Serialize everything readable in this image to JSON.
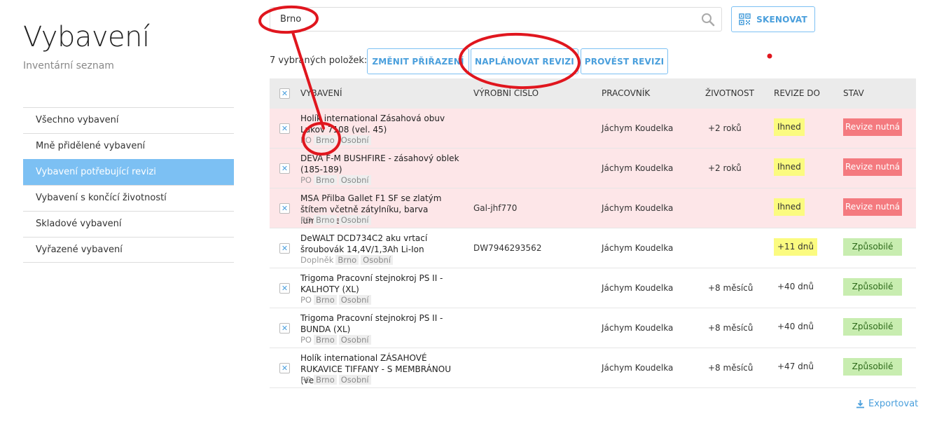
{
  "page": {
    "title": "Vybavení",
    "subtitle": "Inventární seznam"
  },
  "sidebar": {
    "items": [
      {
        "label": "Všechno vybavení",
        "active": false
      },
      {
        "label": "Mně přidělené vybavení",
        "active": false
      },
      {
        "label": "Vybavení potřebující revizi",
        "active": true
      },
      {
        "label": "Vybavení s končící životností",
        "active": false
      },
      {
        "label": "Skladové vybavení",
        "active": false
      },
      {
        "label": "Vyřazené vybavení",
        "active": false
      }
    ]
  },
  "search": {
    "value": "Brno",
    "icon": "search-icon"
  },
  "scan_button": {
    "label": "SKENOVAT",
    "icon": "qr-code-icon"
  },
  "actions": {
    "selected_count": "7 vybraných položek:",
    "change_label": "ZMĚNIT PŘIŘAZENÍ",
    "plan_label": "NAPLÁNOVAT REVIZI",
    "do_label": "PROVÉST REVIZI"
  },
  "table": {
    "headers": {
      "equipment": "Vybavení",
      "serial": "Výrobní číslo",
      "worker": "Pracovník",
      "life": "Životnost",
      "revision": "Revize do",
      "status": "Stav"
    },
    "rows": [
      {
        "name": "Holík international Zásahová obuv Lukov 7108 (vel. 45)",
        "tags": [
          "PO",
          "Brno",
          "Osobní"
        ],
        "serial": "",
        "worker": "Jáchym Koudelka",
        "life": "+2 roků",
        "revision": "Ihned",
        "status": "Revize nutná"
      },
      {
        "name": "DEVA F-M BUSHFIRE - zásahový oblek (185-189)",
        "tags": [
          "PO",
          "Brno",
          "Osobní"
        ],
        "serial": "",
        "worker": "Jáchym Koudelka",
        "life": "+2 roků",
        "revision": "Ihned",
        "status": "Revize nutná"
      },
      {
        "name": "MSA Přilba Gallet F1 SF se zlatým štítem včetně zátylníku, barva luminiscenční",
        "tags": [
          "PO",
          "Brno",
          "Osobní"
        ],
        "serial": "Gal-jhf770",
        "worker": "Jáchym Koudelka",
        "life": "",
        "revision": "Ihned",
        "status": "Revize nutná"
      },
      {
        "name": "DeWALT DCD734C2 aku vrtací šroubovák 14,4V/1,3Ah Li-Ion",
        "tags": [
          "Doplněk",
          "Brno",
          "Osobní"
        ],
        "serial": "DW7946293562",
        "worker": "Jáchym Koudelka",
        "life": "",
        "revision": "+11 dnů",
        "status": "Způsobilé"
      },
      {
        "name": "Trigoma Pracovní stejnokroj PS II - KALHOTY (XL)",
        "tags": [
          "PO",
          "Brno",
          "Osobní"
        ],
        "serial": "",
        "worker": "Jáchym Koudelka",
        "life": "+8 měsíců",
        "revision": "+40 dnů",
        "status": "Způsobilé"
      },
      {
        "name": "Trigoma Pracovní stejnokroj PS II - BUNDA (XL)",
        "tags": [
          "PO",
          "Brno",
          "Osobní"
        ],
        "serial": "",
        "worker": "Jáchym Koudelka",
        "life": "+8 měsíců",
        "revision": "+40 dnů",
        "status": "Způsobilé"
      },
      {
        "name": "Holík international ZÁSAHOVÉ RUKAVICE TIFFANY - S MEMBRÁNOU (vel. 10)",
        "tags": [
          "PO",
          "Brno",
          "Osobní"
        ],
        "serial": "",
        "worker": "Jáchym Koudelka",
        "life": "+8 měsíců",
        "revision": "+47 dnů",
        "status": "Způsobilé"
      }
    ]
  },
  "export": {
    "label": "Exportovat",
    "icon": "download-icon"
  },
  "colors": {
    "accent": "#4a9fdc",
    "sidebar_active": "#7cc0f3",
    "alert_row": "#fde6e8",
    "status_bad": "#f47a7f",
    "status_ok": "#c8edb0",
    "revision_highlight": "#fbfb80",
    "annotation": "#e0161e"
  }
}
